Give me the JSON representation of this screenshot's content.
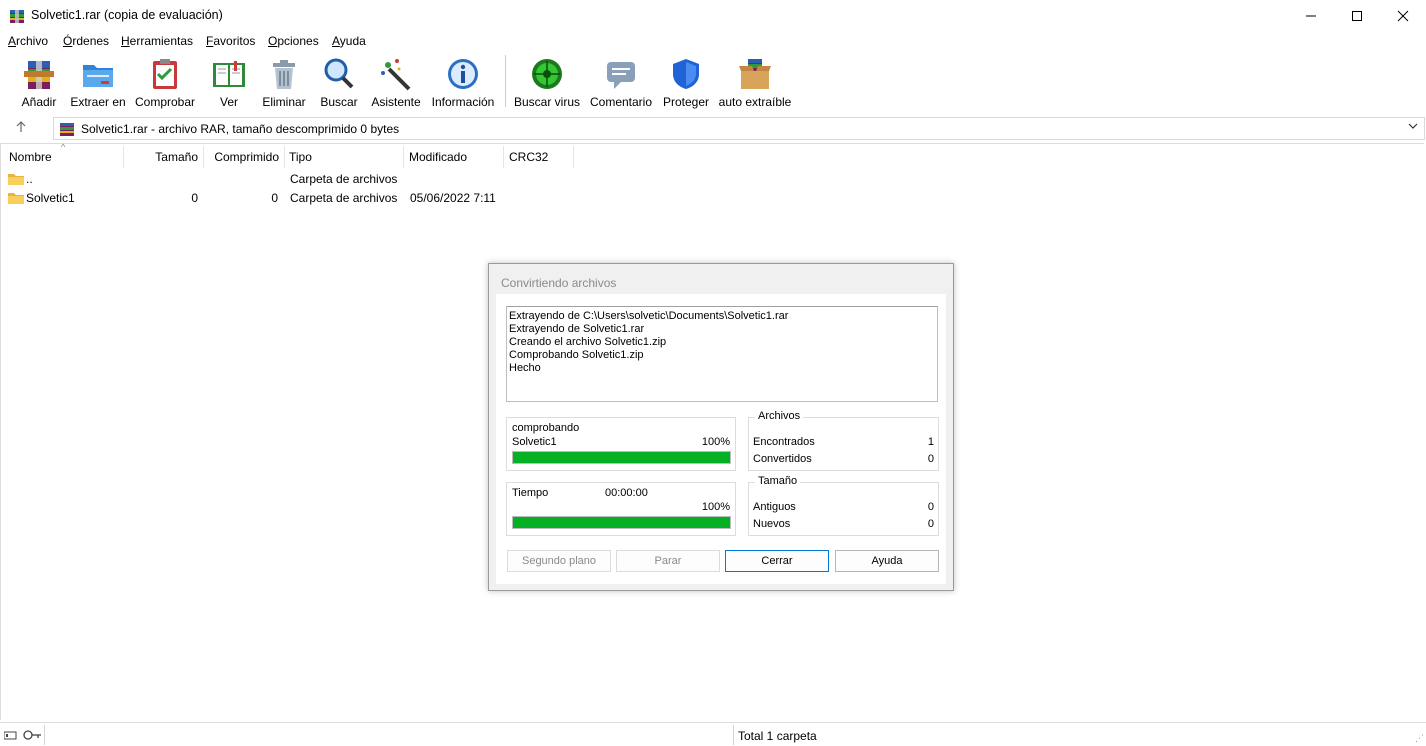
{
  "window": {
    "title": "Solvetic1.rar (copia de evaluación)"
  },
  "menu": [
    {
      "label": "Archivo",
      "u": "A",
      "rest": "rchivo"
    },
    {
      "label": "Órdenes",
      "u": "Ó",
      "rest": "rdenes"
    },
    {
      "label": "Herramientas",
      "u": "H",
      "rest": "erramientas"
    },
    {
      "label": "Favoritos",
      "u": "F",
      "rest": "avoritos"
    },
    {
      "label": "Opciones",
      "u": "O",
      "rest": "pciones"
    },
    {
      "label": "Ayuda",
      "u": "A",
      "rest": "yuda"
    }
  ],
  "toolbar": [
    {
      "label": "Añadir",
      "icon": "add-archive-icon"
    },
    {
      "label": "Extraer en",
      "icon": "extract-folder-icon"
    },
    {
      "label": "Comprobar",
      "icon": "test-clipboard-icon"
    },
    {
      "label": "Ver",
      "icon": "view-book-icon"
    },
    {
      "label": "Eliminar",
      "icon": "trash-icon"
    },
    {
      "label": "Buscar",
      "icon": "magnifier-icon"
    },
    {
      "label": "Asistente",
      "icon": "wizard-wand-icon"
    },
    {
      "label": "Información",
      "icon": "info-icon"
    },
    {
      "label": "Buscar virus",
      "icon": "virus-scan-icon"
    },
    {
      "label": "Comentario",
      "icon": "comment-icon"
    },
    {
      "label": "Proteger",
      "icon": "shield-icon"
    },
    {
      "label": "auto extraíble",
      "icon": "sfx-box-icon"
    }
  ],
  "address": {
    "text": "Solvetic1.rar - archivo RAR, tamaño descomprimido 0 bytes"
  },
  "columns": [
    "Nombre",
    "Tamaño",
    "Comprimido",
    "Tipo",
    "Modificado",
    "CRC32"
  ],
  "rows": [
    {
      "name": "..",
      "size": "",
      "packed": "",
      "type": "Carpeta de archivos",
      "modified": "",
      "crc": ""
    },
    {
      "name": "Solvetic1",
      "size": "0",
      "packed": "0",
      "type": "Carpeta de archivos",
      "modified": "05/06/2022 7:11",
      "crc": ""
    }
  ],
  "dialog": {
    "title": "Convirtiendo archivos",
    "log": [
      "Extrayendo de C:\\Users\\solvetic\\Documents\\Solvetic1.rar",
      "Extrayendo de Solvetic1.rar",
      "Creando el archivo Solvetic1.zip",
      "Comprobando Solvetic1.zip",
      "Hecho"
    ],
    "progress1": {
      "status": "comprobando",
      "item": "Solvetic1",
      "percent_text": "100%",
      "fraction": 1.0
    },
    "progress2": {
      "label": "Tiempo",
      "time": "00:00:00",
      "percent_text": "100%",
      "fraction": 1.0
    },
    "archivos": {
      "legend": "Archivos",
      "encontrados_label": "Encontrados",
      "encontrados": "1",
      "convertidos_label": "Convertidos",
      "convertidos": "0"
    },
    "tamano": {
      "legend": "Tamaño",
      "antiguos_label": "Antiguos",
      "antiguos": "0",
      "nuevos_label": "Nuevos",
      "nuevos": "0"
    },
    "buttons": {
      "background": "Segundo plano",
      "stop": "Parar",
      "close": "Cerrar",
      "help": "Ayuda"
    }
  },
  "status": {
    "text": "Total 1 carpeta"
  },
  "colors": {
    "progress": "#06b025",
    "default_button_border": "#0078d4"
  }
}
